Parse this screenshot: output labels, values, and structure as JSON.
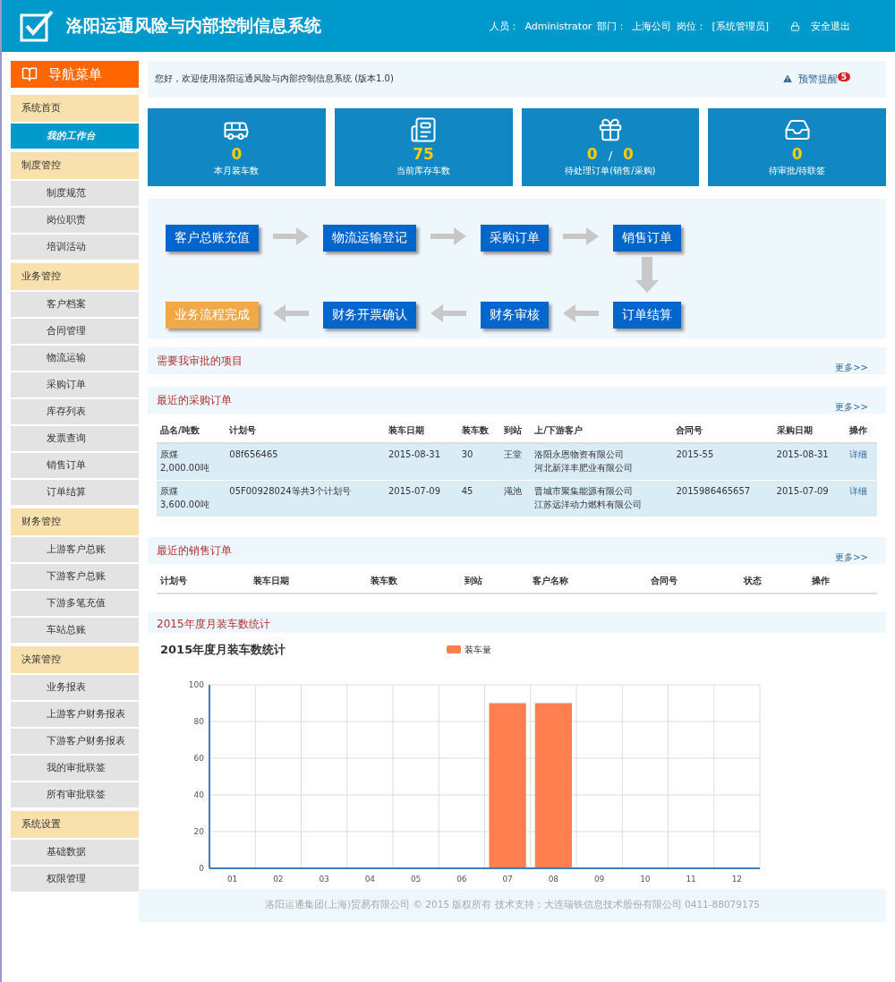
{
  "header": {
    "title": "洛阳运通风险与内部控制信息系统",
    "user_label": "人员：",
    "user": "Administrator",
    "dept_label": "部门：",
    "dept": "上海公司",
    "role_label": "岗位：",
    "role": "[系统管理员]",
    "logout": "安全退出"
  },
  "sidebar": {
    "title": "导航菜单",
    "groups": [
      {
        "label": "系统首页",
        "items": [
          {
            "label": "我的工作台",
            "selected": true
          }
        ]
      },
      {
        "label": "制度管控",
        "items": [
          {
            "label": "制度规范",
            "selected": false
          },
          {
            "label": "岗位职责",
            "selected": false
          },
          {
            "label": "培训活动",
            "selected": false
          }
        ]
      },
      {
        "label": "业务管控",
        "items": [
          {
            "label": "客户档案",
            "selected": false
          },
          {
            "label": "合同管理",
            "selected": false
          },
          {
            "label": "物流运输",
            "selected": false
          },
          {
            "label": "采购订单",
            "selected": false
          },
          {
            "label": "库存列表",
            "selected": false
          },
          {
            "label": "发票查询",
            "selected": false
          },
          {
            "label": "销售订单",
            "selected": false
          },
          {
            "label": "订单结算",
            "selected": false
          }
        ]
      },
      {
        "label": "财务管控",
        "items": [
          {
            "label": "上游客户总账",
            "selected": false
          },
          {
            "label": "下游客户总账",
            "selected": false
          },
          {
            "label": "下游多笔充值",
            "selected": false
          },
          {
            "label": "车站总账",
            "selected": false
          }
        ]
      },
      {
        "label": "决策管控",
        "items": [
          {
            "label": "业务报表",
            "selected": false
          },
          {
            "label": "上游客户财务报表",
            "selected": false
          },
          {
            "label": "下游客户财务报表",
            "selected": false
          },
          {
            "label": "我的审批联签",
            "selected": false
          },
          {
            "label": "所有审批联签",
            "selected": false
          }
        ]
      },
      {
        "label": "系统设置",
        "items": [
          {
            "label": "基础数据",
            "selected": false
          },
          {
            "label": "权限管理",
            "selected": false
          }
        ]
      }
    ]
  },
  "welcome": {
    "text": "您好，欢迎使用洛阳运通风险与内部控制信息系统 (版本1.0)",
    "alert": "预警提醒",
    "alert_count": "5"
  },
  "stats": [
    {
      "values": [
        "0"
      ],
      "label": "本月装车数"
    },
    {
      "values": [
        "75"
      ],
      "label": "当前库存车数"
    },
    {
      "values": [
        "0",
        "0"
      ],
      "separator": "/",
      "label": "待处理订单(销售/采购)"
    },
    {
      "values": [
        "0"
      ],
      "label": "待审批/待联签"
    }
  ],
  "flow": {
    "top": [
      {
        "label": "客户总账充值",
        "kind": "step"
      },
      {
        "label": "物流运输登记",
        "kind": "step"
      },
      {
        "label": "采购订单",
        "kind": "step"
      },
      {
        "label": "销售订单",
        "kind": "step"
      }
    ],
    "bottom": [
      {
        "label": "业务流程完成",
        "kind": "done"
      },
      {
        "label": "财务开票确认",
        "kind": "step"
      },
      {
        "label": "财务审核",
        "kind": "step"
      },
      {
        "label": "订单结算",
        "kind": "step"
      }
    ]
  },
  "approvals": {
    "title": "需要我审批的项目",
    "more": "更多>>"
  },
  "purchase": {
    "title": "最近的采购订单",
    "more": "更多>>",
    "columns": [
      "品名/吨数",
      "计划号",
      "装车日期",
      "装车数",
      "到站",
      "上/下游客户",
      "合同号",
      "采购日期",
      "操作"
    ],
    "rows": [
      {
        "cells": [
          [
            "原煤",
            "2,000.00吨"
          ],
          [
            "08f656465"
          ],
          [
            "2015-08-31"
          ],
          [
            "30"
          ],
          [
            "王堂"
          ],
          [
            "洛阳永恩物资有限公司",
            "河北新洋丰肥业有限公司"
          ],
          [
            "2015-55"
          ],
          [
            "2015-08-31"
          ]
        ],
        "action": "详细"
      },
      {
        "cells": [
          [
            "原煤",
            "3,600.00吨"
          ],
          [
            "05F00928024等共3个计划号"
          ],
          [
            "2015-07-09"
          ],
          [
            "45"
          ],
          [
            "渑池"
          ],
          [
            "晋城市聚集能源有限公司",
            "江苏远洋动力燃料有限公司"
          ],
          [
            "2015986465657"
          ],
          [
            "2015-07-09"
          ]
        ],
        "action": "详细"
      }
    ]
  },
  "sales": {
    "title": "最近的销售订单",
    "more": "更多>>",
    "columns": [
      "计划号",
      "装车日期",
      "装车数",
      "到站",
      "客户名称",
      "合同号",
      "状态",
      "操作"
    ]
  },
  "stats_chart": {
    "section_title": "2015年度月装车数统计",
    "chart_data": {
      "type": "bar",
      "title": "2015年度月装车数统计",
      "categories": [
        "01",
        "02",
        "03",
        "04",
        "05",
        "06",
        "07",
        "08",
        "09",
        "10",
        "11",
        "12"
      ],
      "series": [
        {
          "name": "装车量",
          "color": "#ff7f50",
          "values": [
            0,
            0,
            0,
            0,
            0,
            0,
            90,
            90,
            0,
            0,
            0,
            0
          ]
        }
      ],
      "ylim": [
        0,
        100
      ],
      "yticks": [
        0,
        20,
        40,
        60,
        80,
        100
      ],
      "grid": true
    }
  },
  "footer": "洛阳运通集团(上海)贸易有限公司 © 2015 版权所有 技术支持：大连瑞铁信息技术股份有限公司 0411-88079175"
}
